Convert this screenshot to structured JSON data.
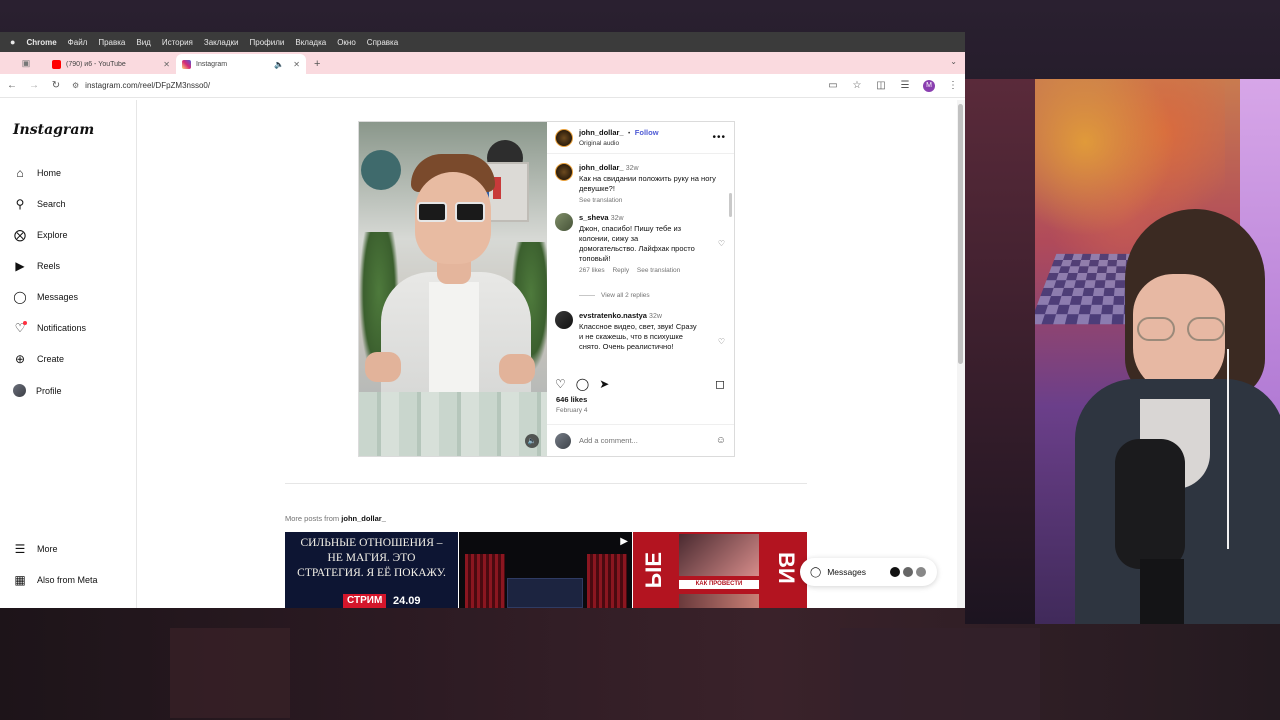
{
  "menubar": {
    "apple": "",
    "items": [
      "Chrome",
      "Файл",
      "Правка",
      "Вид",
      "История",
      "Закладки",
      "Профили",
      "Вкладка",
      "Окно",
      "Справка"
    ]
  },
  "browser": {
    "tabs": [
      {
        "title": "(790) и6 - YouTube",
        "favicon_color": "#ff0000",
        "active": false
      },
      {
        "title": "Instagram",
        "favicon_color": "#d62976",
        "active": true
      }
    ],
    "url": "instagram.com/reel/DFpZM3nsso0/",
    "profile_initial": "M"
  },
  "instagram": {
    "logo": "Instagram",
    "nav": [
      {
        "label": "Home",
        "icon": "home-icon"
      },
      {
        "label": "Search",
        "icon": "search-icon"
      },
      {
        "label": "Explore",
        "icon": "compass-icon"
      },
      {
        "label": "Reels",
        "icon": "reels-icon"
      },
      {
        "label": "Messages",
        "icon": "messenger-icon"
      },
      {
        "label": "Notifications",
        "icon": "heart-icon"
      },
      {
        "label": "Create",
        "icon": "plus-icon"
      },
      {
        "label": "Profile",
        "icon": "avatar-icon"
      }
    ],
    "nav_bottom": [
      {
        "label": "More",
        "icon": "menu-icon"
      },
      {
        "label": "Also from Meta",
        "icon": "meta-icon"
      }
    ],
    "post": {
      "author": "john_dollar_",
      "follow": "Follow",
      "separator": "•",
      "audio": "Original audio",
      "caption_author": "john_dollar_",
      "caption_time": "32w",
      "caption": "Как на свидании положить руку на ногу девушке?!",
      "caption_translate": "See translation",
      "comments": [
        {
          "user": "s_sheva",
          "time": "32w",
          "text": "Джон, спасибо! Пишу тебе из колонии, сижу за домогательство. Лайфхак просто топовый!",
          "likes": "267 likes",
          "reply": "Reply",
          "translate": "See translation",
          "view_replies": "View all 2 replies"
        },
        {
          "user": "evstratenko.nastya",
          "time": "32w",
          "text": "Классное видео, свет, звук! Сразу и не скажешь, что в психушке снято. Очень реалистично!"
        }
      ],
      "likes": "646 likes",
      "date": "February 4",
      "add_comment_placeholder": "Add a comment..."
    },
    "more_posts_prefix": "More posts from",
    "more_posts_user": "john_dollar_",
    "thumbs": [
      {
        "text": "СИЛЬНЫЕ ОТНОШЕНИЯ – НЕ МАГИЯ. ЭТО СТРАТЕГИЯ. Я ЕЁ ПОКАЖУ.",
        "badge": "СТРИМ",
        "badge_date": "24.09"
      },
      {
        "text": ""
      },
      {
        "left_text": "ЫЕ",
        "right_text": "ВИ",
        "caption": "КАК ПРОВЕСТИ"
      }
    ],
    "messages_pill": "Messages"
  }
}
